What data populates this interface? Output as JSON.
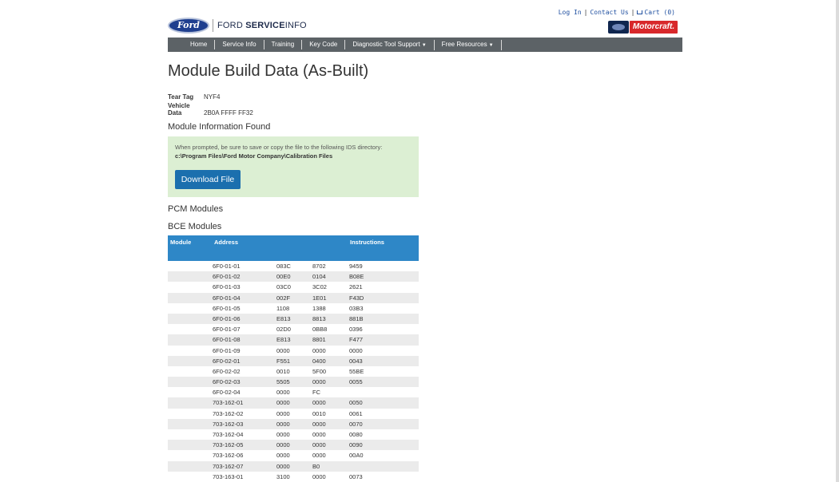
{
  "header": {
    "logo_text": "Ford",
    "brand_prefix": "FORD",
    "brand_bold": "SERVICE",
    "brand_suffix": "INFO",
    "links": {
      "login": "Log In",
      "contact": "Contact Us",
      "cart": "Cart (0)",
      "sep": "|"
    },
    "motorcraft": "Motorcraft."
  },
  "nav": [
    {
      "label": "Home"
    },
    {
      "label": "Service Info"
    },
    {
      "label": "Training"
    },
    {
      "label": "Key Code"
    },
    {
      "label": "Diagnostic Tool Support",
      "caret": "▼"
    },
    {
      "label": "Free Resources",
      "caret": "▼"
    }
  ],
  "page_title": "Module Build Data (As-Built)",
  "tear_tag": {
    "label": "Tear Tag",
    "value": "NYF4"
  },
  "vehicle_data": {
    "label": "Vehicle Data",
    "value": "2B0A FFFF FF32"
  },
  "module_info": {
    "heading": "Module Information Found",
    "message": "When prompted, be sure to save or copy the file to the following IDS directory:",
    "path": "c:\\Program Files\\Ford Motor Company\\Calibration Files",
    "download_label": "Download File"
  },
  "sections": {
    "pcm": "PCM Modules",
    "bce": "BCE Modules"
  },
  "table": {
    "headers": {
      "module": "Module",
      "address": "Address",
      "instructions": "Instructions"
    },
    "rows": [
      [
        "6F0-01-01",
        "083C",
        "8702",
        "9459"
      ],
      [
        "6F0-01-02",
        "00E0",
        "0104",
        "B08E"
      ],
      [
        "6F0-01-03",
        "03C0",
        "3C02",
        "2621"
      ],
      [
        "6F0-01-04",
        "002F",
        "1E01",
        "F43D"
      ],
      [
        "6F0-01-05",
        "1108",
        "1388",
        "03B3"
      ],
      [
        "6F0-01-06",
        "E813",
        "8813",
        "881B"
      ],
      [
        "6F0-01-07",
        "02D0",
        "0BB8",
        "0396"
      ],
      [
        "6F0-01-08",
        "E813",
        "8801",
        "F477"
      ],
      [
        "6F0-01-09",
        "0000",
        "0000",
        "0000"
      ],
      [
        "6F0-02-01",
        "F551",
        "0400",
        "0043"
      ],
      [
        "6F0-02-02",
        "0010",
        "5F00",
        "55BE"
      ],
      [
        "6F0-02-03",
        "5505",
        "0000",
        "0055"
      ],
      [
        "6F0-02-04",
        "0000",
        "FC",
        ""
      ],
      [
        "703-162-01",
        "0000",
        "0000",
        "0050"
      ],
      [
        "703-162-02",
        "0000",
        "0010",
        "0061"
      ],
      [
        "703-162-03",
        "0000",
        "0000",
        "0070"
      ],
      [
        "703-162-04",
        "0000",
        "0000",
        "0080"
      ],
      [
        "703-162-05",
        "0000",
        "0000",
        "0090"
      ],
      [
        "703-162-06",
        "0000",
        "0000",
        "00A0"
      ],
      [
        "703-162-07",
        "0000",
        "B0",
        ""
      ],
      [
        "703-163-01",
        "3100",
        "0000",
        "0073"
      ]
    ]
  }
}
